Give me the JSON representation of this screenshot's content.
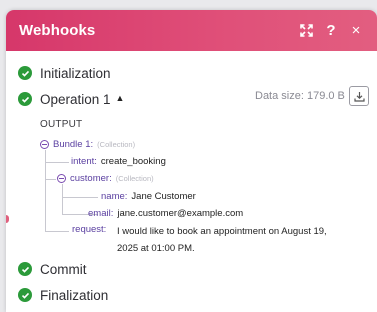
{
  "window": {
    "title": "Webhooks",
    "help_glyph": "?",
    "close_glyph": "×"
  },
  "operations": [
    {
      "label": "Initialization",
      "status": "success"
    },
    {
      "label": "Operation 1",
      "status": "success",
      "expanded": true,
      "caret": "▲"
    },
    {
      "label": "Commit",
      "status": "success"
    },
    {
      "label": "Finalization",
      "status": "success"
    }
  ],
  "operation_details": {
    "data_size_label": "Data size: 179.0 B",
    "output_label": "OUTPUT"
  },
  "output_tree": {
    "bundle": {
      "key": "Bundle 1:",
      "type": "(Collection)"
    },
    "intent": {
      "key": "intent:",
      "value": "create_booking"
    },
    "customer": {
      "key": "customer:",
      "type": "(Collection)"
    },
    "name": {
      "key": "name:",
      "value": "Jane Customer"
    },
    "email": {
      "key": "email:",
      "value": "jane.customer@example.com"
    },
    "request": {
      "key": "request:",
      "value": "I would like to book an appointment on August 19, 2025 at 01:00 PM."
    }
  },
  "colors": {
    "header_start": "#d6376a",
    "header_end": "#e25e80",
    "success_green": "#2b9a3a",
    "tree_key_purple": "#5a3fa0"
  },
  "icons": {
    "expand": "expand-arrows-icon",
    "help": "question-icon",
    "close": "close-icon",
    "check": "check-circle-icon",
    "download": "download-icon"
  }
}
